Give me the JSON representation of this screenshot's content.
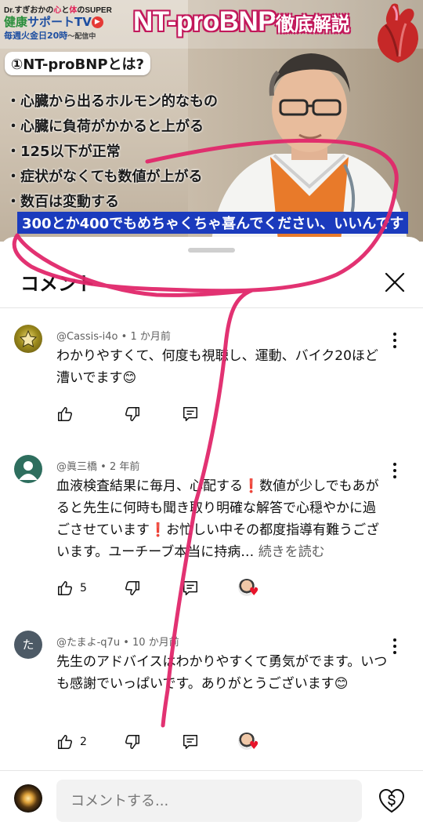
{
  "video": {
    "channel_line1_pre": "Dr.すぎおかの",
    "channel_line1_heart": "心",
    "channel_line1_mid": "と",
    "channel_line1_body": "体",
    "channel_line1_post": "のSUPER",
    "channel_line2_a": "健康",
    "channel_line2_b": "サポートTV",
    "channel_line3": "毎週火金日20時",
    "channel_line3_suffix": "～配信中",
    "title_main": "NT-proBNP",
    "title_suffix": "徹底解説",
    "section_heading": "①NT-proBNPとは?",
    "bullets": [
      "・心臓から出るホルモン的なもの",
      "・心臓に負荷がかかると上がる",
      "・125以下が正常",
      "・症状がなくても数値が上がる",
      "・数百は変動する"
    ],
    "caption": "300とか400でもめちゃくちゃ喜んでください、いいんです"
  },
  "sheet": {
    "title": "コメント"
  },
  "comments": [
    {
      "author": "@Cassis-i4o",
      "time": "1 か月前",
      "text": "わかりやすくて、何度も視聴し、運動、バイク20ほど漕いでます😊",
      "likes": "",
      "read_more": "",
      "creator_heart": false
    },
    {
      "author": "@眞三橋",
      "time": "2 年前",
      "text": "血液検査結果に毎月、心配する❗数値が少しでもあがると先生に何時も聞き取り明確な解答で心穏やかに過ごさせています❗お忙しい中その都度指導有難うございます。ユーチーブ本当に持病…",
      "likes": "5",
      "read_more": "続きを読む",
      "creator_heart": true
    },
    {
      "author": "@たまよ-q7u",
      "avatar_letter": "た",
      "time": "10 か月前",
      "text": "先生のアドバイスはわかりやすくて勇気がでます。いつも感謝でいっぱいです。ありがとうございます😊",
      "likes": "2",
      "read_more": "",
      "creator_heart": true
    }
  ],
  "composer": {
    "placeholder": "コメントする..."
  },
  "colors": {
    "annotation": "#e0276a",
    "caption_bg": "#1b3bbd",
    "heart": "#e8142b",
    "avatar2_bg": "#2e6e5e",
    "avatar3_bg": "#4d5a66"
  },
  "icons": [
    "like-icon",
    "dislike-icon",
    "reply-icon",
    "more-vertical-icon",
    "close-icon",
    "thanks-icon",
    "heart-icon"
  ]
}
